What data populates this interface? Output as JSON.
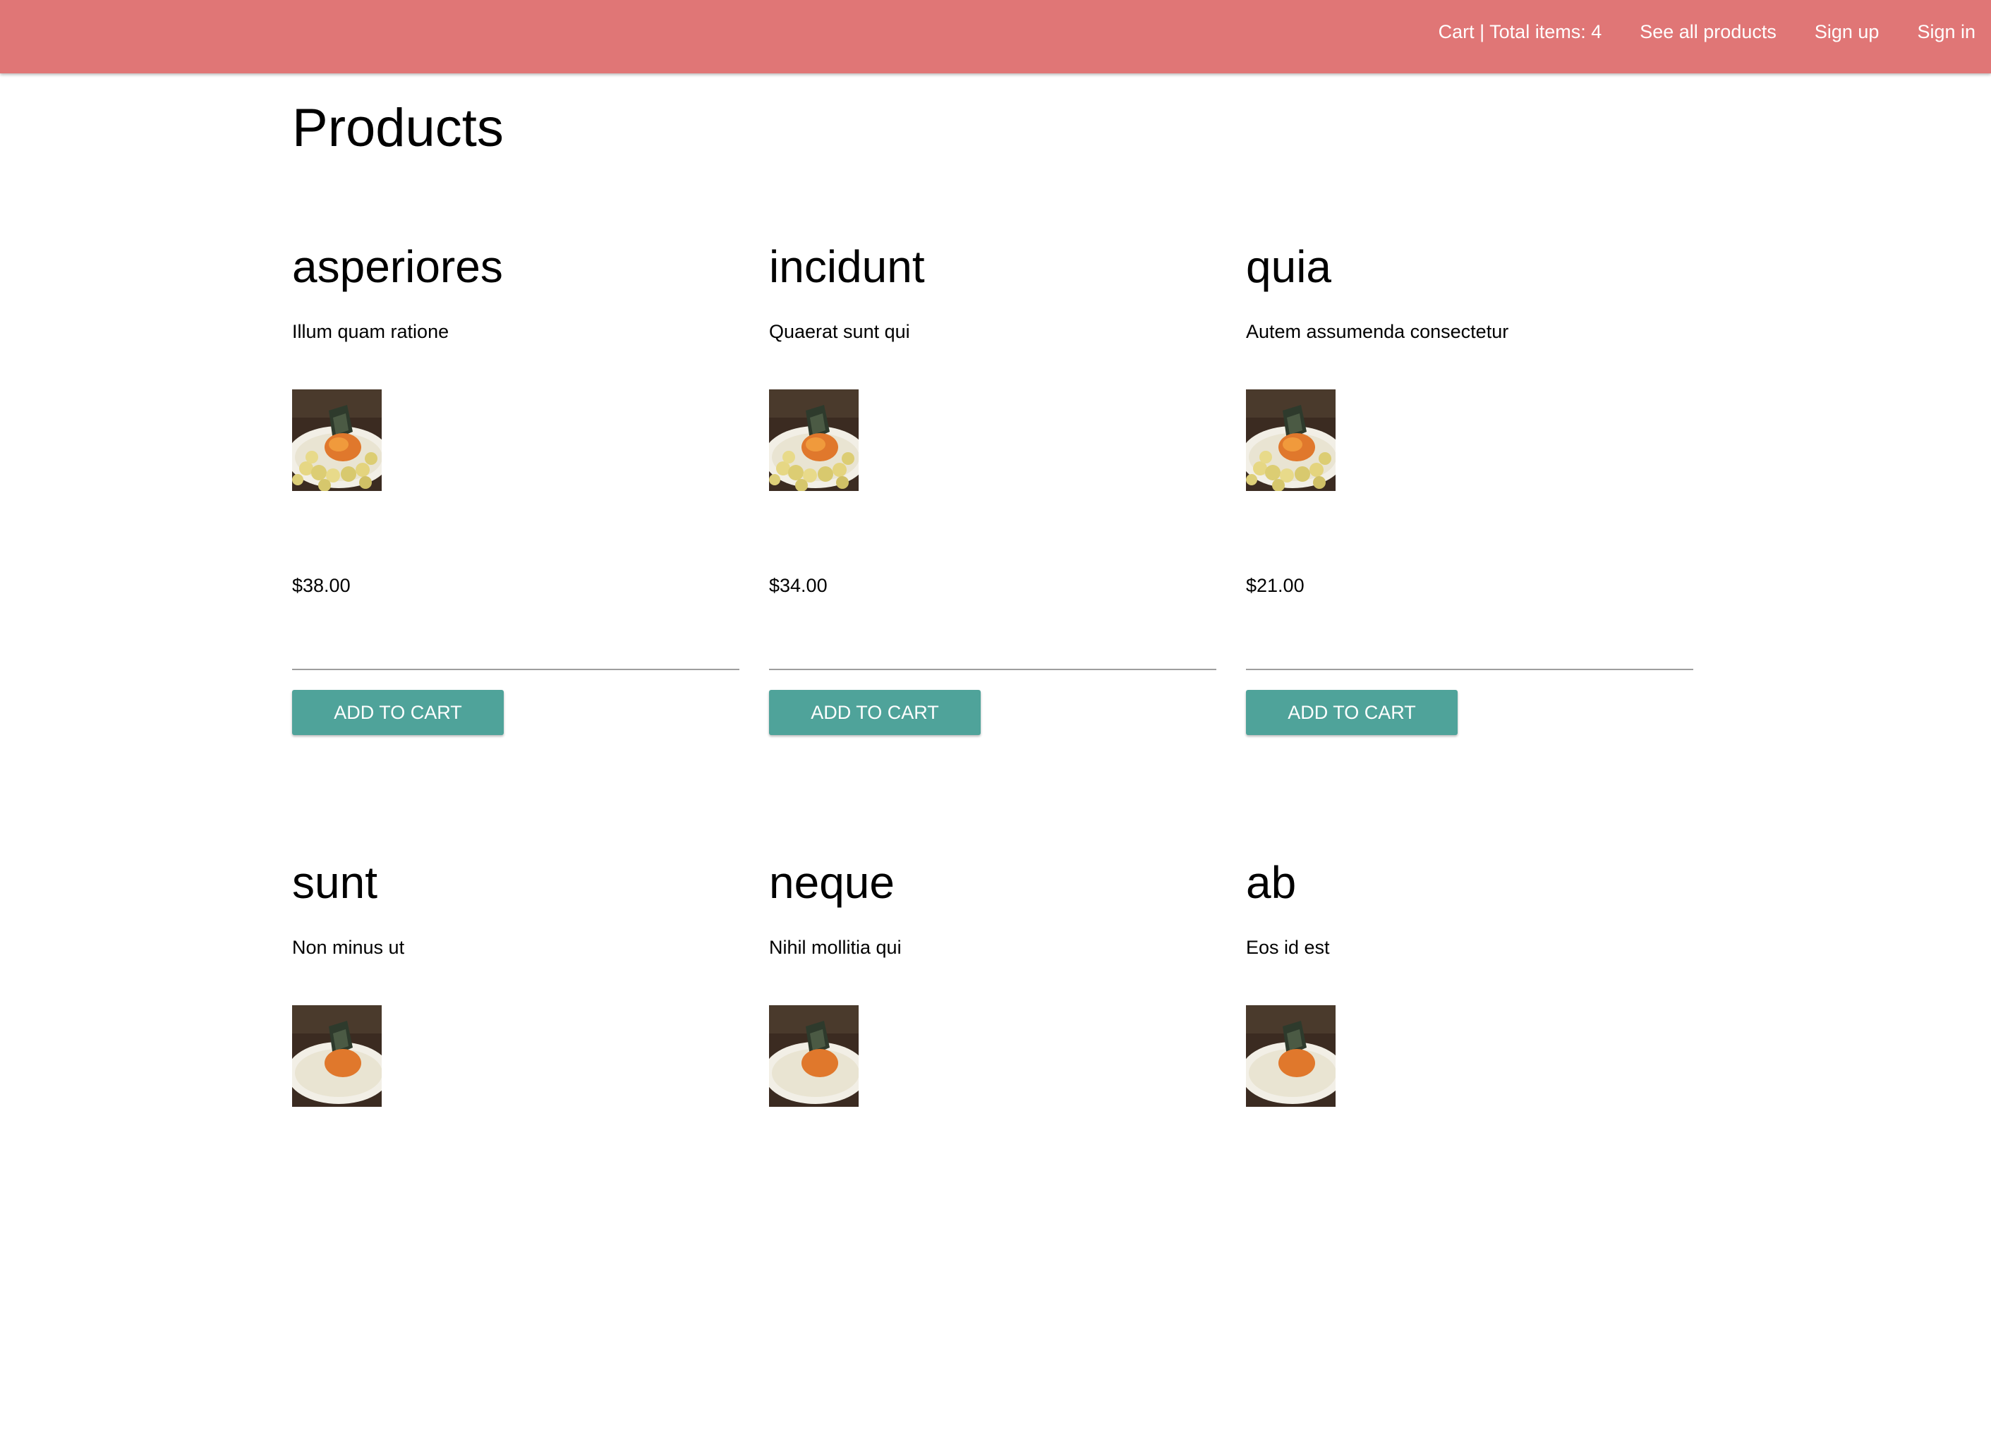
{
  "nav": {
    "cart": "Cart | Total items: 4",
    "products": "See all products",
    "signup": "Sign up",
    "signin": "Sign in"
  },
  "page": {
    "title": "Products"
  },
  "colors": {
    "navbar": "#e07676",
    "button": "#4fa39a"
  },
  "products": [
    {
      "name": "asperiores",
      "description": "Illum quam ratione",
      "price": "$38.00",
      "button": "Add to cart",
      "image": "food-plate-thumbnail"
    },
    {
      "name": "incidunt",
      "description": "Quaerat sunt qui",
      "price": "$34.00",
      "button": "Add to cart",
      "image": "food-plate-thumbnail"
    },
    {
      "name": "quia",
      "description": "Autem assumenda consectetur",
      "price": "$21.00",
      "button": "Add to cart",
      "image": "food-plate-thumbnail"
    },
    {
      "name": "sunt",
      "description": "Non minus ut",
      "price": "",
      "button": "",
      "image": "food-plate-thumbnail"
    },
    {
      "name": "neque",
      "description": "Nihil mollitia qui",
      "price": "",
      "button": "",
      "image": "food-plate-thumbnail"
    },
    {
      "name": "ab",
      "description": "Eos id est",
      "price": "",
      "button": "",
      "image": "food-plate-thumbnail"
    }
  ]
}
